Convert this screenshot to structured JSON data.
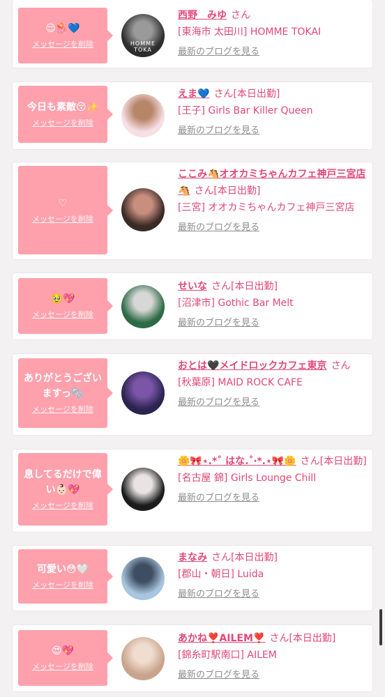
{
  "delete_label": "メッセージを削除",
  "blog_label": "最新のブログを見る",
  "san_label": "さん",
  "cards": [
    {
      "message": "😌🪼💙",
      "name": "西野　みゆ",
      "suffix": "さん",
      "shop": "[東海市 太田川] HOMME TOKAI",
      "avatar_colors": [
        "#2d2d2d",
        "#9a9a9a"
      ],
      "avatar_overlay": "HOMME TOKA"
    },
    {
      "message": "今日も素敵😚✨",
      "name": "えま💙",
      "suffix": "さん[本日出勤]",
      "shop": "[王子] Girls Bar Killer Queen",
      "avatar_colors": [
        "#f7dfe6",
        "#b78567"
      ],
      "avatar_overlay": ""
    },
    {
      "message": "♡",
      "name": "ここみ🐴オオカミちゃんカフェ神戸三宮店🐴",
      "suffix": "さん[本日出勤]",
      "shop": "[三宮] オオカミちゃんカフェ神戸三宮店",
      "avatar_colors": [
        "#3a2a26",
        "#c88f7f"
      ],
      "avatar_overlay": ""
    },
    {
      "message": "🥹💖",
      "name": "せいな",
      "suffix": "さん[本日出勤]",
      "shop": "[沼津市] Gothic Bar Melt",
      "avatar_colors": [
        "#2e6a45",
        "#d7d7d7"
      ],
      "avatar_overlay": ""
    },
    {
      "message": "ありがとうございますっ🫧",
      "name": "おとは🖤メイドロックカフェ東京",
      "suffix": "さん",
      "shop": "[秋葉原] MAID ROCK CAFE",
      "avatar_colors": [
        "#2b2450",
        "#7b56a8"
      ],
      "avatar_overlay": ""
    },
    {
      "message": "息してるだけで偉い👶🏻💖",
      "name": "🌼🎀⋆.*˚ はな.˚‧*.⋆🎀🌼",
      "suffix": "さん[本日出勤]",
      "shop": "[名古屋 錦] Girls Lounge Chill",
      "avatar_colors": [
        "#1b1b1b",
        "#e9e4e3"
      ],
      "avatar_overlay": ""
    },
    {
      "message": "可愛い😳🤍",
      "name": "まなみ",
      "suffix": "さん[本日出勤]",
      "shop": "[郡山・朝日] Luida",
      "avatar_colors": [
        "#a8c6de",
        "#3f4d62"
      ],
      "avatar_overlay": ""
    },
    {
      "message": "😍💖",
      "name": "あかね❣️AILEM❣️",
      "suffix": "さん[本日出勤]",
      "shop": "[錦糸町駅南口] AILEM",
      "avatar_colors": [
        "#c9a48c",
        "#f0ddd0"
      ],
      "avatar_overlay": ""
    }
  ]
}
